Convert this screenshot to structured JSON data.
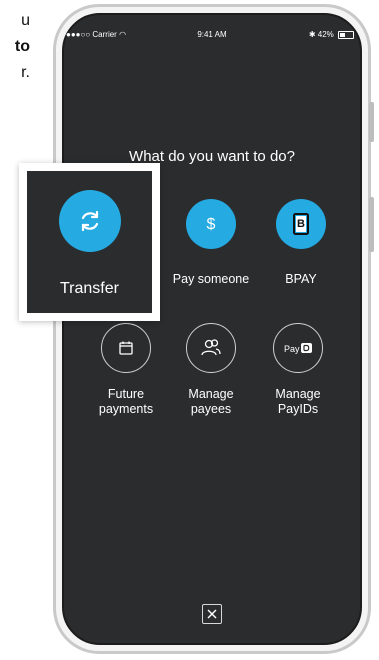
{
  "background_text": {
    "line1": "u",
    "line2": "to",
    "line3": "r."
  },
  "status_bar": {
    "carrier": "●●●○○ Carrier",
    "time": "9:41 AM",
    "battery": "42%"
  },
  "screen": {
    "question": "What do you want to do?",
    "highlighted_action": {
      "label": "Transfer",
      "icon": "refresh-icon"
    },
    "actions": [
      {
        "label": "Pay someone",
        "icon": "dollar-icon"
      },
      {
        "label": "BPAY",
        "icon": "bpay-icon"
      }
    ],
    "secondary_actions": [
      {
        "label_line1": "Future",
        "label_line2": "payments",
        "icon": "calendar-icon"
      },
      {
        "label_line1": "Manage",
        "label_line2": "payees",
        "icon": "people-icon"
      },
      {
        "label_line1": "Manage",
        "label_line2": "PayIDs",
        "icon": "payid-icon",
        "icon_text": "Pay"
      }
    ],
    "close": {
      "icon": "close-icon"
    }
  },
  "colors": {
    "accent": "#25aae1",
    "screen_bg": "#2b2c2e",
    "text": "#ffffff"
  }
}
